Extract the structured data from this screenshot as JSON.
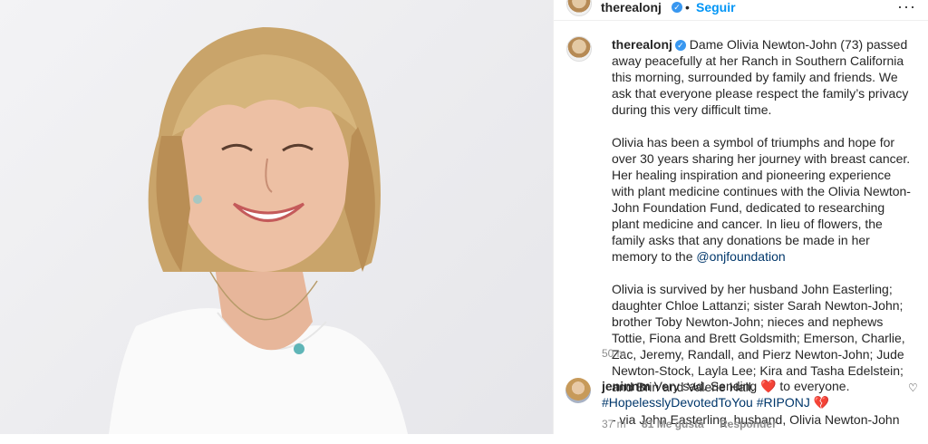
{
  "header": {
    "username": "therealonj",
    "follow_label": "Seguir",
    "separator": "•",
    "more_label": "···"
  },
  "caption": {
    "username": "therealonj",
    "p1": "Dame Olivia Newton-John (73) passed away peacefully at her Ranch in Southern California this morning, surrounded by family and friends. We ask that everyone please respect the family’s privacy during this very difficult time.",
    "p2_before": "Olivia has been a symbol of triumphs and hope for over 30 years sharing her journey with breast cancer. Her healing inspiration and pioneering experience with plant medicine continues with the Olivia Newton-John Foundation Fund, dedicated to researching plant medicine and cancer. In lieu of flowers, the family asks that any donations be made in her memory to the ",
    "p2_mention": "@onjfoundation",
    "p3": "Olivia is survived by her husband John Easterling; daughter Chloe Lattanzi; sister Sarah Newton-John; brother Toby Newton-John; nieces and nephews Tottie, Fiona and Brett Goldsmith; Emerson, Charlie, Zac, Jeremy, Randall, and Pierz Newton-John; Jude Newton-Stock, Layla Lee; Kira and Tasha Edelstein; and Brin and Valerie Hall.",
    "p4": "- via John Easterling, husband, Olivia Newton-John",
    "time": "50 m"
  },
  "comment": {
    "username": "jeninnm",
    "text_before": "Very sad. Sending ",
    "heart": "❤️",
    "text_after": " to everyone.",
    "hashtags": "#HopelesslyDevotedToYou #RIPONJ",
    "heart2": "💔",
    "time": "37 m",
    "likes": "81 Me gusta",
    "reply_label": "Responder",
    "like_icon": "♡"
  },
  "colors": {
    "link": "#0095f6",
    "mention": "#00376b",
    "heart": "#ed4956"
  }
}
